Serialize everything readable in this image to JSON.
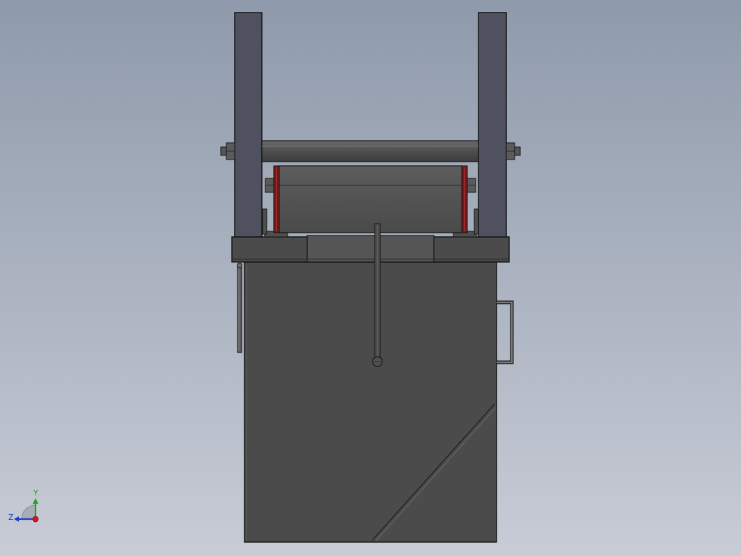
{
  "viewport": {
    "background_top": "#8e9aab",
    "background_bottom": "#c8ccd6"
  },
  "colors": {
    "frame_post": "#4f525e",
    "body_dark": "#4b4b4b",
    "body_mid": "#555555",
    "roller": "#505050",
    "edge": "#141414",
    "bearing_red": "#8b1a1a",
    "handle_light": "#7a7a7a"
  },
  "triad": {
    "y_label": "Y",
    "z_label": "Z",
    "y_color": "#18a818",
    "z_color": "#1c3cc8",
    "x_color": "#d81818"
  }
}
